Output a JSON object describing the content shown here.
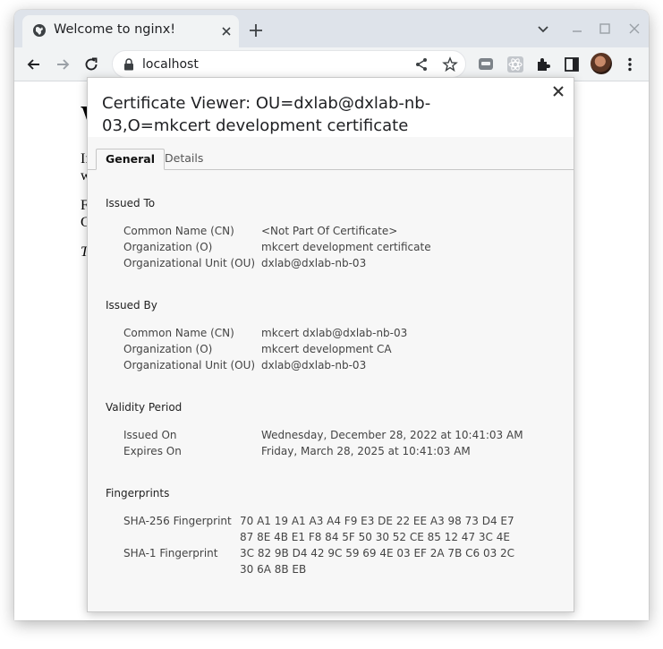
{
  "browser": {
    "tab_title": "Welcome to nginx!",
    "url": "localhost"
  },
  "page_background": {
    "heading": "W",
    "line1a": "If",
    "line1b": "w",
    "line2a": "F",
    "line2b": "C",
    "line3": "T"
  },
  "dialog": {
    "title": "Certificate Viewer: OU=dxlab@dxlab-nb-03,O=mkcert development certificate",
    "tabs": [
      "General",
      "Details"
    ],
    "issued_to": {
      "heading": "Issued To",
      "rows": [
        {
          "label": "Common Name (CN)",
          "value": "<Not Part Of Certificate>"
        },
        {
          "label": "Organization (O)",
          "value": "mkcert development certificate"
        },
        {
          "label": "Organizational Unit (OU)",
          "value": "dxlab@dxlab-nb-03"
        }
      ]
    },
    "issued_by": {
      "heading": "Issued By",
      "rows": [
        {
          "label": "Common Name (CN)",
          "value": "mkcert dxlab@dxlab-nb-03"
        },
        {
          "label": "Organization (O)",
          "value": "mkcert development CA"
        },
        {
          "label": "Organizational Unit (OU)",
          "value": "dxlab@dxlab-nb-03"
        }
      ]
    },
    "validity": {
      "heading": "Validity Period",
      "rows": [
        {
          "label": "Issued On",
          "value": "Wednesday, December 28, 2022 at 10:41:03 AM"
        },
        {
          "label": "Expires On",
          "value": "Friday, March 28, 2025 at 10:41:03 AM"
        }
      ]
    },
    "fingerprints": {
      "heading": "Fingerprints",
      "rows": [
        {
          "label": "SHA-256 Fingerprint",
          "line1": "70 A1 19 A1 A3 A4 F9 E3 DE 22 EE A3 98 73 D4 E7",
          "line2": "87 8E 4B E1 F8 84 5F 50 30 52 CE 85 12 47 3C 4E"
        },
        {
          "label": "SHA-1 Fingerprint",
          "line1": "3C 82 9B D4 42 9C 59 69 4E 03 EF 2A 7B C6 03 2C",
          "line2": "30 6A 8B EB"
        }
      ]
    }
  }
}
